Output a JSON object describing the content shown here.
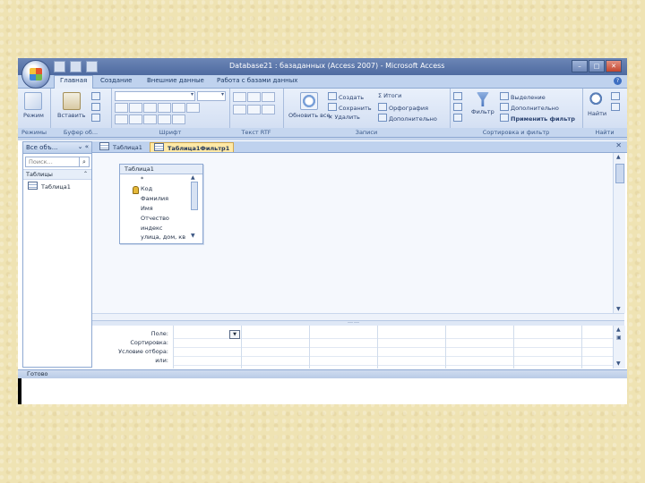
{
  "window": {
    "title": "Database21 : базаданных (Access 2007) - Microsoft Access"
  },
  "ribbon_tabs": [
    "Главная",
    "Создание",
    "Внешние данные",
    "Работа с базами данных"
  ],
  "ribbon": {
    "views": {
      "label": "Режим",
      "group": "Режимы"
    },
    "clipboard": {
      "paste": "Вставить",
      "group": "Буфер об..."
    },
    "font": {
      "group": "Шрифт"
    },
    "richtext": {
      "group": "Текст RTF"
    },
    "records": {
      "refresh": "Обновить все",
      "new": "Создать",
      "save": "Сохранить",
      "delete": "Удалить",
      "totals": "Итоги",
      "spelling": "Орфография",
      "more": "Дополнительно",
      "group": "Записи"
    },
    "sortfilter": {
      "filter": "Фильтр",
      "selection": "Выделение",
      "advanced": "Дополнительно",
      "apply": "Применить фильтр",
      "group": "Сортировка и фильтр"
    },
    "find": {
      "find": "Найти",
      "group": "Найти"
    }
  },
  "nav": {
    "header": "Все объ...",
    "search_placeholder": "Поиск...",
    "group": "Таблицы",
    "items": [
      "Таблица1"
    ]
  },
  "doc_tabs": [
    "Таблица1",
    "Таблица1Фильтр1"
  ],
  "table_box": {
    "title": "Таблица1",
    "fields": [
      "*",
      "Код",
      "Фамилия",
      "Имя",
      "Отчество",
      "индекс",
      "улица, дом, кв"
    ]
  },
  "grid": {
    "row_labels": [
      "Поле:",
      "Сортировка:",
      "Условие отбора:",
      "или:"
    ]
  },
  "status": "Готово"
}
